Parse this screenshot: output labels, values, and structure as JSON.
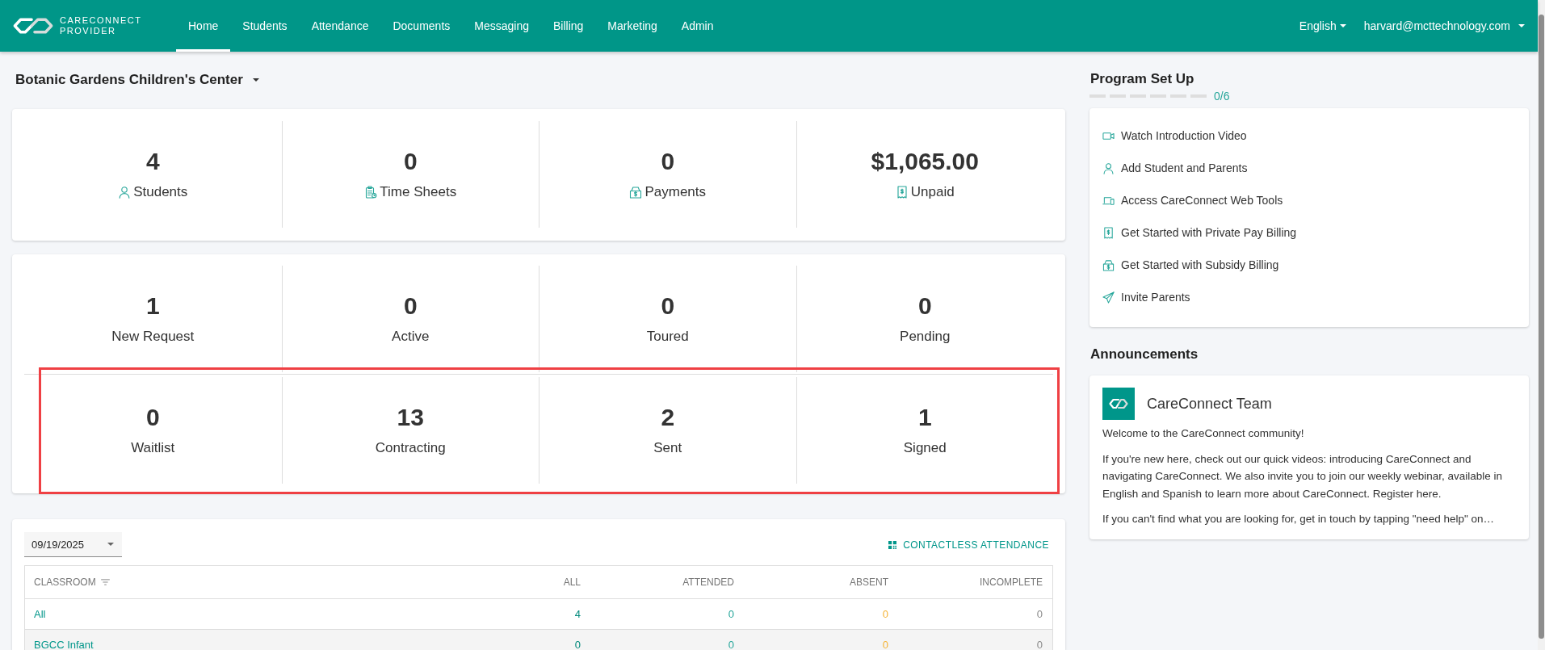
{
  "nav": {
    "brand": {
      "line_1": "CARECONNECT",
      "line_2": "PROVIDER"
    },
    "tabs": [
      {
        "label": "Home",
        "selected": true
      },
      {
        "label": "Students",
        "selected": false
      },
      {
        "label": "Attendance",
        "selected": false
      },
      {
        "label": "Documents",
        "selected": false
      },
      {
        "label": "Messaging",
        "selected": false
      },
      {
        "label": "Billing",
        "selected": false
      },
      {
        "label": "Marketing",
        "selected": false
      },
      {
        "label": "Admin",
        "selected": false
      }
    ],
    "language": "English",
    "user": "harvard@mcttechnology.com"
  },
  "center": {
    "name": "Botanic Gardens Children's Center"
  },
  "summary": [
    {
      "kind": "students",
      "value": "4",
      "label": "Students"
    },
    {
      "kind": "time_sheets",
      "value": "0",
      "label": "Time Sheets"
    },
    {
      "kind": "payments",
      "value": "0",
      "label": "Payments"
    },
    {
      "kind": "unpaid",
      "value": "$1,065.00",
      "label": "Unpaid"
    }
  ],
  "pipeline": {
    "rows": [
      {
        "highlighted": false,
        "items": [
          {
            "value": "1",
            "label": "New Request"
          },
          {
            "value": "0",
            "label": "Active"
          },
          {
            "value": "0",
            "label": "Toured"
          },
          {
            "value": "0",
            "label": "Pending"
          }
        ]
      },
      {
        "highlighted": true,
        "items": [
          {
            "value": "0",
            "label": "Waitlist"
          },
          {
            "value": "13",
            "label": "Contracting"
          },
          {
            "value": "2",
            "label": "Sent"
          },
          {
            "value": "1",
            "label": "Signed"
          }
        ]
      }
    ]
  },
  "attendance": {
    "date": "09/19/2025",
    "action": "CONTACTLESS ATTENDANCE",
    "columns": [
      {
        "label": "CLASSROOM",
        "filterable": true
      },
      {
        "label": "ALL",
        "filterable": false
      },
      {
        "label": "ATTENDED",
        "filterable": false
      },
      {
        "label": "ABSENT",
        "filterable": false
      },
      {
        "label": "INCOMPLETE",
        "filterable": false
      }
    ],
    "rows": [
      {
        "classroom": "All",
        "values": [
          "4",
          "0",
          "0",
          "0"
        ]
      },
      {
        "classroom": "BGCC Infant",
        "values": [
          "0",
          "0",
          "0",
          "0"
        ]
      }
    ]
  },
  "program_setup": {
    "title": "Program Set Up",
    "progress": "0/6",
    "items": [
      {
        "kind": "video",
        "label": "Watch Introduction Video",
        "completed": false
      },
      {
        "kind": "students",
        "label": "Add Student and Parents",
        "completed": false
      },
      {
        "kind": "web_tools",
        "label": "Access CareConnect Web Tools",
        "completed": false
      },
      {
        "kind": "private_pay",
        "label": "Get Started with Private Pay Billing",
        "completed": false
      },
      {
        "kind": "subsidy",
        "label": "Get Started with Subsidy Billing",
        "completed": false
      },
      {
        "kind": "invite",
        "label": "Invite Parents",
        "completed": false
      }
    ]
  },
  "announcements": {
    "title": "Announcements",
    "posts": [
      {
        "author": "CareConnect Team",
        "paragraphs": [
          "Welcome to the CareConnect community!",
          "If you're new here, check out our quick videos: introducing CareConnect and navigating CareConnect. We also invite you to join our weekly webinar, available in English and Spanish to learn more about CareConnect. Register here.",
          "If you can't find what you are looking for, get in touch by tapping \"need help\" on…"
        ]
      }
    ]
  }
}
